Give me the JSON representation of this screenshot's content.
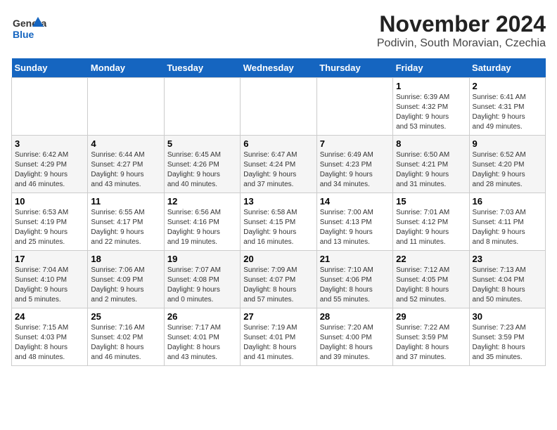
{
  "header": {
    "logo_line1": "General",
    "logo_line2": "Blue",
    "title": "November 2024",
    "subtitle": "Podivin, South Moravian, Czechia"
  },
  "calendar": {
    "days_of_week": [
      "Sunday",
      "Monday",
      "Tuesday",
      "Wednesday",
      "Thursday",
      "Friday",
      "Saturday"
    ],
    "weeks": [
      [
        {
          "day": "",
          "info": ""
        },
        {
          "day": "",
          "info": ""
        },
        {
          "day": "",
          "info": ""
        },
        {
          "day": "",
          "info": ""
        },
        {
          "day": "",
          "info": ""
        },
        {
          "day": "1",
          "info": "Sunrise: 6:39 AM\nSunset: 4:32 PM\nDaylight: 9 hours\nand 53 minutes."
        },
        {
          "day": "2",
          "info": "Sunrise: 6:41 AM\nSunset: 4:31 PM\nDaylight: 9 hours\nand 49 minutes."
        }
      ],
      [
        {
          "day": "3",
          "info": "Sunrise: 6:42 AM\nSunset: 4:29 PM\nDaylight: 9 hours\nand 46 minutes."
        },
        {
          "day": "4",
          "info": "Sunrise: 6:44 AM\nSunset: 4:27 PM\nDaylight: 9 hours\nand 43 minutes."
        },
        {
          "day": "5",
          "info": "Sunrise: 6:45 AM\nSunset: 4:26 PM\nDaylight: 9 hours\nand 40 minutes."
        },
        {
          "day": "6",
          "info": "Sunrise: 6:47 AM\nSunset: 4:24 PM\nDaylight: 9 hours\nand 37 minutes."
        },
        {
          "day": "7",
          "info": "Sunrise: 6:49 AM\nSunset: 4:23 PM\nDaylight: 9 hours\nand 34 minutes."
        },
        {
          "day": "8",
          "info": "Sunrise: 6:50 AM\nSunset: 4:21 PM\nDaylight: 9 hours\nand 31 minutes."
        },
        {
          "day": "9",
          "info": "Sunrise: 6:52 AM\nSunset: 4:20 PM\nDaylight: 9 hours\nand 28 minutes."
        }
      ],
      [
        {
          "day": "10",
          "info": "Sunrise: 6:53 AM\nSunset: 4:19 PM\nDaylight: 9 hours\nand 25 minutes."
        },
        {
          "day": "11",
          "info": "Sunrise: 6:55 AM\nSunset: 4:17 PM\nDaylight: 9 hours\nand 22 minutes."
        },
        {
          "day": "12",
          "info": "Sunrise: 6:56 AM\nSunset: 4:16 PM\nDaylight: 9 hours\nand 19 minutes."
        },
        {
          "day": "13",
          "info": "Sunrise: 6:58 AM\nSunset: 4:15 PM\nDaylight: 9 hours\nand 16 minutes."
        },
        {
          "day": "14",
          "info": "Sunrise: 7:00 AM\nSunset: 4:13 PM\nDaylight: 9 hours\nand 13 minutes."
        },
        {
          "day": "15",
          "info": "Sunrise: 7:01 AM\nSunset: 4:12 PM\nDaylight: 9 hours\nand 11 minutes."
        },
        {
          "day": "16",
          "info": "Sunrise: 7:03 AM\nSunset: 4:11 PM\nDaylight: 9 hours\nand 8 minutes."
        }
      ],
      [
        {
          "day": "17",
          "info": "Sunrise: 7:04 AM\nSunset: 4:10 PM\nDaylight: 9 hours\nand 5 minutes."
        },
        {
          "day": "18",
          "info": "Sunrise: 7:06 AM\nSunset: 4:09 PM\nDaylight: 9 hours\nand 2 minutes."
        },
        {
          "day": "19",
          "info": "Sunrise: 7:07 AM\nSunset: 4:08 PM\nDaylight: 9 hours\nand 0 minutes."
        },
        {
          "day": "20",
          "info": "Sunrise: 7:09 AM\nSunset: 4:07 PM\nDaylight: 8 hours\nand 57 minutes."
        },
        {
          "day": "21",
          "info": "Sunrise: 7:10 AM\nSunset: 4:06 PM\nDaylight: 8 hours\nand 55 minutes."
        },
        {
          "day": "22",
          "info": "Sunrise: 7:12 AM\nSunset: 4:05 PM\nDaylight: 8 hours\nand 52 minutes."
        },
        {
          "day": "23",
          "info": "Sunrise: 7:13 AM\nSunset: 4:04 PM\nDaylight: 8 hours\nand 50 minutes."
        }
      ],
      [
        {
          "day": "24",
          "info": "Sunrise: 7:15 AM\nSunset: 4:03 PM\nDaylight: 8 hours\nand 48 minutes."
        },
        {
          "day": "25",
          "info": "Sunrise: 7:16 AM\nSunset: 4:02 PM\nDaylight: 8 hours\nand 46 minutes."
        },
        {
          "day": "26",
          "info": "Sunrise: 7:17 AM\nSunset: 4:01 PM\nDaylight: 8 hours\nand 43 minutes."
        },
        {
          "day": "27",
          "info": "Sunrise: 7:19 AM\nSunset: 4:01 PM\nDaylight: 8 hours\nand 41 minutes."
        },
        {
          "day": "28",
          "info": "Sunrise: 7:20 AM\nSunset: 4:00 PM\nDaylight: 8 hours\nand 39 minutes."
        },
        {
          "day": "29",
          "info": "Sunrise: 7:22 AM\nSunset: 3:59 PM\nDaylight: 8 hours\nand 37 minutes."
        },
        {
          "day": "30",
          "info": "Sunrise: 7:23 AM\nSunset: 3:59 PM\nDaylight: 8 hours\nand 35 minutes."
        }
      ]
    ]
  }
}
